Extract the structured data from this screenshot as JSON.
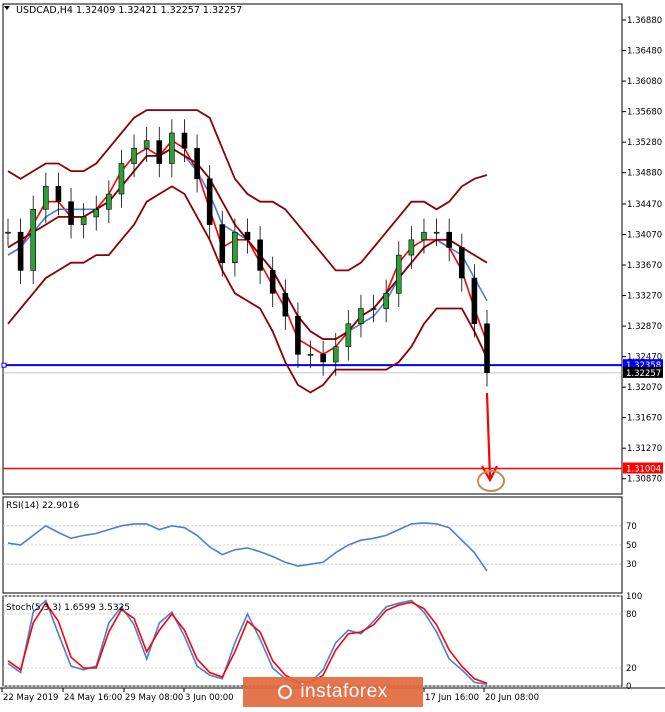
{
  "header": {
    "title": "USDCAD,H4",
    "quote": "1.32409 1.32421 1.32257 1.32257"
  },
  "chart_data": [
    {
      "type": "line",
      "title": "USDCAD,H4 1.32409 1.32421 1.32257 1.32257",
      "ylim": [
        1.3067,
        1.3709
      ],
      "x_tick_labels": [
        "22 May 2019",
        "24 May 16:00",
        "29 May 08:00",
        "3 Jun 00:00",
        "17 Jun 16:00",
        "20 Jun 08:00"
      ],
      "y_tick_labels": [
        "1.36880",
        "1.36480",
        "1.36080",
        "1.35680",
        "1.35280",
        "1.34880",
        "1.34470",
        "1.34070",
        "1.33670",
        "1.33270",
        "1.32870",
        "1.32470",
        "1.32070",
        "1.31670",
        "1.31270",
        "1.30870"
      ],
      "price_labels": [
        {
          "value": 1.32358,
          "label": "1.32358",
          "color": "#0000ff"
        },
        {
          "value": 1.32257,
          "label": "1.32257",
          "color": "#000000"
        },
        {
          "value": 1.31004,
          "label": "1.31004",
          "color": "#ff0000"
        }
      ],
      "series": [
        {
          "key": "close",
          "values": [
            1.341,
            1.336,
            1.344,
            1.347,
            1.345,
            1.342,
            1.343,
            1.344,
            1.346,
            1.35,
            1.352,
            1.353,
            1.35,
            1.354,
            1.352,
            1.348,
            1.342,
            1.337,
            1.341,
            1.34,
            1.336,
            1.333,
            1.33,
            1.325,
            1.325,
            1.324,
            1.326,
            1.329,
            1.331,
            1.331,
            1.333,
            1.338,
            1.34,
            1.341,
            1.341,
            1.339,
            1.335,
            1.329,
            1.3226
          ]
        },
        {
          "key": "ma_fast",
          "color": "#ff0000",
          "values": [
            1.338,
            1.339,
            1.342,
            1.345,
            1.345,
            1.343,
            1.343,
            1.344,
            1.346,
            1.349,
            1.351,
            1.352,
            1.351,
            1.353,
            1.352,
            1.349,
            1.344,
            1.339,
            1.34,
            1.34,
            1.337,
            1.334,
            1.331,
            1.327,
            1.326,
            1.325,
            1.326,
            1.328,
            1.33,
            1.331,
            1.333,
            1.337,
            1.339,
            1.34,
            1.34,
            1.339,
            1.336,
            1.331,
            1.3265
          ]
        },
        {
          "key": "ma_slow",
          "color": "#4a7fd6",
          "values": [
            1.338,
            1.339,
            1.341,
            1.343,
            1.344,
            1.344,
            1.344,
            1.344,
            1.345,
            1.347,
            1.349,
            1.351,
            1.351,
            1.352,
            1.351,
            1.349,
            1.346,
            1.342,
            1.341,
            1.34,
            1.338,
            1.336,
            1.333,
            1.33,
            1.328,
            1.327,
            1.327,
            1.328,
            1.329,
            1.33,
            1.332,
            1.335,
            1.337,
            1.339,
            1.34,
            1.339,
            1.338,
            1.335,
            1.332
          ]
        },
        {
          "key": "bb_upper",
          "color": "#8b0000",
          "values": [
            1.349,
            1.348,
            1.349,
            1.35,
            1.35,
            1.349,
            1.349,
            1.35,
            1.352,
            1.354,
            1.356,
            1.357,
            1.357,
            1.357,
            1.357,
            1.357,
            1.356,
            1.352,
            1.348,
            1.346,
            1.345,
            1.345,
            1.344,
            1.342,
            1.34,
            1.338,
            1.336,
            1.336,
            1.337,
            1.339,
            1.341,
            1.343,
            1.345,
            1.345,
            1.344,
            1.345,
            1.347,
            1.348,
            1.3485
          ]
        },
        {
          "key": "bb_middle",
          "color": "#8b0000",
          "values": [
            1.339,
            1.34,
            1.341,
            1.342,
            1.343,
            1.343,
            1.343,
            1.344,
            1.345,
            1.347,
            1.349,
            1.351,
            1.351,
            1.352,
            1.351,
            1.35,
            1.348,
            1.345,
            1.342,
            1.34,
            1.338,
            1.336,
            1.333,
            1.33,
            1.328,
            1.327,
            1.327,
            1.328,
            1.33,
            1.331,
            1.333,
            1.335,
            1.337,
            1.339,
            1.34,
            1.34,
            1.339,
            1.338,
            1.337
          ]
        },
        {
          "key": "bb_lower",
          "color": "#8b0000",
          "values": [
            1.329,
            1.331,
            1.333,
            1.335,
            1.336,
            1.337,
            1.337,
            1.338,
            1.338,
            1.34,
            1.342,
            1.345,
            1.346,
            1.347,
            1.346,
            1.343,
            1.34,
            1.336,
            1.333,
            1.332,
            1.331,
            1.328,
            1.324,
            1.321,
            1.32,
            1.321,
            1.323,
            1.323,
            1.323,
            1.323,
            1.323,
            1.324,
            1.326,
            1.329,
            1.331,
            1.331,
            1.331,
            1.328,
            1.3245
          ]
        }
      ]
    },
    {
      "type": "line",
      "title": "RSI(14) 22.9016",
      "ylim": [
        0,
        100
      ],
      "y_tick_labels": [
        "70",
        "50",
        "30"
      ],
      "y_tick_values": [
        70,
        50,
        30
      ],
      "series": [
        {
          "key": "rsi",
          "color": "#4a7fd6",
          "values": [
            52,
            50,
            60,
            70,
            63,
            57,
            60,
            62,
            66,
            70,
            72,
            72,
            66,
            70,
            68,
            60,
            48,
            40,
            45,
            47,
            43,
            38,
            32,
            28,
            30,
            32,
            42,
            50,
            55,
            57,
            60,
            66,
            72,
            73,
            72,
            68,
            55,
            42,
            23
          ]
        }
      ]
    },
    {
      "type": "line",
      "title": "Stoch(5,3,3) 1.6599 3.5325",
      "ylim": [
        0,
        100
      ],
      "y_tick_labels": [
        "100",
        "80",
        "20",
        "0"
      ],
      "y_tick_values": [
        100,
        80,
        20,
        0
      ],
      "series": [
        {
          "key": "main",
          "color": "#4a7fd6",
          "values": [
            25,
            15,
            82,
            95,
            58,
            22,
            18,
            22,
            70,
            88,
            68,
            30,
            70,
            82,
            55,
            22,
            12,
            8,
            48,
            80,
            52,
            20,
            8,
            3,
            4,
            18,
            48,
            62,
            58,
            72,
            88,
            92,
            95,
            82,
            60,
            30,
            18,
            4,
            2
          ]
        },
        {
          "key": "signal",
          "color": "#ff0000",
          "values": [
            28,
            18,
            70,
            92,
            72,
            32,
            20,
            20,
            60,
            85,
            75,
            38,
            62,
            80,
            62,
            30,
            15,
            10,
            38,
            72,
            60,
            28,
            12,
            5,
            4,
            12,
            40,
            58,
            60,
            68,
            84,
            90,
            93,
            86,
            68,
            40,
            22,
            8,
            3
          ]
        }
      ]
    }
  ]
}
